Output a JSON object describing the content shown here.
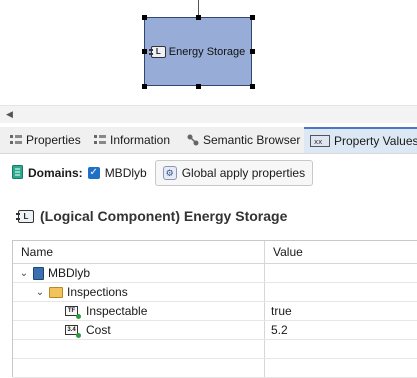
{
  "diagram": {
    "node_label": "Energy Storage",
    "node_icon": "logical-component-icon",
    "node_fill": "#97acd6"
  },
  "tabs": [
    {
      "label": "Properties",
      "icon": "properties-icon",
      "active": false
    },
    {
      "label": "Information",
      "icon": "information-icon",
      "active": false
    },
    {
      "label": "Semantic Browser",
      "icon": "semantic-browser-icon",
      "active": false
    },
    {
      "label": "Property Values",
      "icon": "property-values-icon",
      "active": true
    }
  ],
  "domains": {
    "label": "Domains:",
    "checkbox_label": "MBDlyb",
    "checked": true,
    "global_button": "Global apply properties"
  },
  "section_title": "(Logical Component) Energy Storage",
  "table": {
    "headers": {
      "name": "Name",
      "value": "Value"
    },
    "rows": [
      {
        "name": "MBDlyb",
        "value": "",
        "icon": "book-icon",
        "expanded": true
      },
      {
        "name": "Inspections",
        "value": "",
        "icon": "folder-icon",
        "expanded": true
      },
      {
        "name": "Inspectable",
        "value": "true",
        "icon": "boolean-property-icon"
      },
      {
        "name": "Cost",
        "value": "5.2",
        "icon": "number-property-icon"
      }
    ]
  }
}
